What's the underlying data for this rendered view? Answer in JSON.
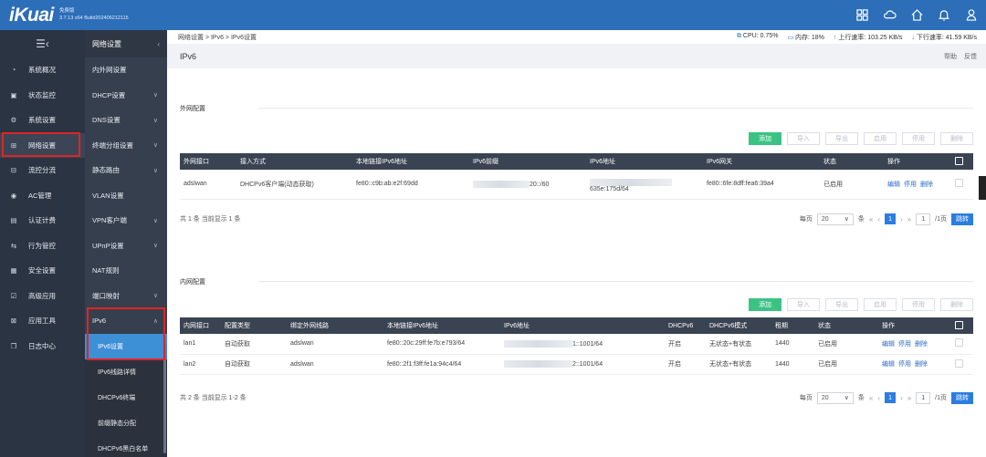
{
  "brand": {
    "logo": "iKuai",
    "edition": "免费版",
    "build": "3.7.13 x64 Build202406212115"
  },
  "topbar_icons": [
    "grid-icon",
    "cloud-icon",
    "home-icon",
    "bell-icon",
    "user-icon"
  ],
  "nav_primary": [
    {
      "label": "系统概况",
      "icon": "dashboard-icon"
    },
    {
      "label": "状态监控",
      "icon": "monitor-icon"
    },
    {
      "label": "系统设置",
      "icon": "gear-icon"
    },
    {
      "label": "网络设置",
      "icon": "network-icon",
      "active": true
    },
    {
      "label": "流控分流",
      "icon": "flow-icon"
    },
    {
      "label": "AC管理",
      "icon": "ac-icon"
    },
    {
      "label": "认证计费",
      "icon": "auth-icon"
    },
    {
      "label": "行为管控",
      "icon": "behavior-icon"
    },
    {
      "label": "安全设置",
      "icon": "security-icon"
    },
    {
      "label": "高级应用",
      "icon": "advanced-icon"
    },
    {
      "label": "应用工具",
      "icon": "tools-icon"
    },
    {
      "label": "日志中心",
      "icon": "log-icon"
    }
  ],
  "nav_secondary": {
    "title": "网络设置",
    "items": [
      {
        "label": "内外网设置",
        "arrow": false
      },
      {
        "label": "DHCP设置",
        "arrow": true
      },
      {
        "label": "DNS设置",
        "arrow": true
      },
      {
        "label": "终端分组设置",
        "arrow": true
      },
      {
        "label": "静态路由",
        "arrow": true
      },
      {
        "label": "VLAN设置",
        "arrow": false
      },
      {
        "label": "VPN客户端",
        "arrow": true
      },
      {
        "label": "UPnP设置",
        "arrow": true
      },
      {
        "label": "NAT规则",
        "arrow": false
      },
      {
        "label": "端口映射",
        "arrow": true
      },
      {
        "label": "IPv6",
        "arrow": true,
        "expanded": true
      }
    ],
    "sub_items": [
      {
        "label": "IPv6设置",
        "active": true
      },
      {
        "label": "IPv6线路详情"
      },
      {
        "label": "DHCPv6终端"
      },
      {
        "label": "前缀静态分配"
      },
      {
        "label": "DHCPv6黑白名单"
      }
    ]
  },
  "breadcrumb": "网络设置 > IPv6 > IPv6设置",
  "stats": {
    "cpu": "CPU: 0.75%",
    "mem": "内存: 18%",
    "up": "上行速率: 103.25 KB/s",
    "down": "下行速率: 41.59 KB/s"
  },
  "page_title": "IPv6",
  "title_links": [
    "帮助",
    "反馈"
  ],
  "buttons": [
    "添加",
    "导入",
    "导出",
    "启用",
    "停用",
    "删除"
  ],
  "wan": {
    "label": "外网配置",
    "headers": [
      "外网接口",
      "接入方式",
      "本地链接IPv6地址",
      "IPv6前缀",
      "IPv6地址",
      "IPv6网关",
      "状态",
      "操作"
    ],
    "rows": [
      {
        "iface": "adslwan",
        "mode": "DHCPv6客户端(动态获取)",
        "link": "fe80::c9b:ab:e2f:69dd",
        "prefix": "20::/60",
        "addr": "635e:175d/64",
        "gw": "fe80::6fe:8dff:fea6:39a4",
        "status": "已启用",
        "ops": [
          "编辑",
          "停用",
          "删除"
        ]
      }
    ],
    "summary": "共 1 条 当前显示 1 条"
  },
  "lan": {
    "label": "内网配置",
    "headers": [
      "内网接口",
      "配置类型",
      "绑定外网线路",
      "本地链接IPv6地址",
      "IPv6地址",
      "DHCPv6",
      "DHCPv6模式",
      "租期",
      "状态",
      "操作"
    ],
    "rows": [
      {
        "iface": "lan1",
        "type": "自动获取",
        "bind": "adslwan",
        "link": "fe80::20c:29ff:fe7b:e793/64",
        "addr": "1::1001/64",
        "dhcp": "开启",
        "mode": "无状态+有状态",
        "lease": "1440",
        "status": "已启用",
        "ops": [
          "编辑",
          "停用",
          "删除"
        ]
      },
      {
        "iface": "lan2",
        "type": "自动获取",
        "bind": "adslwan",
        "link": "fe80::2f1:f3ff:fe1a:94c4/64",
        "addr": "2::1001/64",
        "dhcp": "开启",
        "mode": "无状态+有状态",
        "lease": "1440",
        "status": "已启用",
        "ops": [
          "编辑",
          "停用",
          "删除"
        ]
      }
    ],
    "summary": "共 2 条 当前显示 1-2 条"
  },
  "pager": {
    "per_page_label": "每页",
    "per_page": "20",
    "unit": "条",
    "current": "1",
    "page_input": "1",
    "total_pages": "/1页",
    "go": "跳转"
  }
}
